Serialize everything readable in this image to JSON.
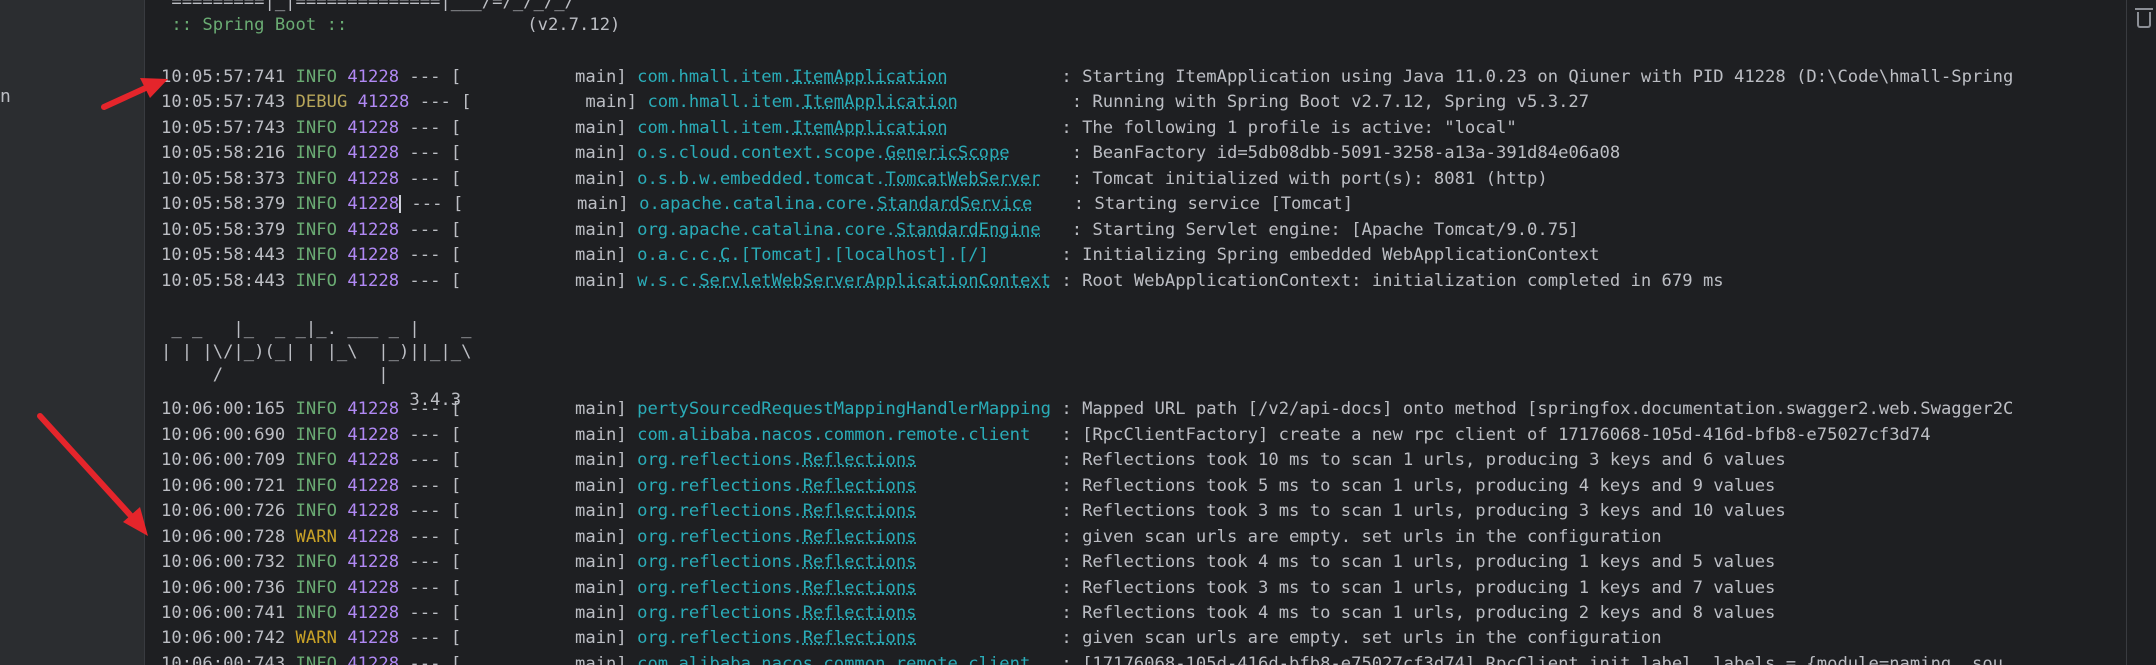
{
  "sidebar": {
    "fragment": "n"
  },
  "banner": {
    "top": " =========|_|==============|___/=/_/_/_/",
    "spring_boot": " :: Spring Boot ::",
    "version": "(v2.7.12)",
    "mp1": " _ _   |_  _ _|_. ___ _ |    _",
    "mp2": "| | |\\/|_)(_| | |_\\  |_)||_|_\\",
    "mp3": "     /               |",
    "mp4": "                        3.4.3"
  },
  "logs": [
    {
      "time": "10:05:57:741",
      "level": "INFO",
      "pid": "41228",
      "sep": "--- [",
      "thread": "           main]",
      "pkg": "com.hmall.item.",
      "cls": "ItemApplication",
      "pad": "           ",
      "msg": ": Starting ItemApplication using Java 11.0.23 on Qiuner with PID 41228 (D:\\Code\\hmall-Spring"
    },
    {
      "time": "10:05:57:743",
      "level": "DEBUG",
      "pid": "41228",
      "sep": "--- [",
      "thread": "           main]",
      "pkg": "com.hmall.item.",
      "cls": "ItemApplication",
      "pad": "           ",
      "msg": ": Running with Spring Boot v2.7.12, Spring v5.3.27"
    },
    {
      "time": "10:05:57:743",
      "level": "INFO",
      "pid": "41228",
      "sep": "--- [",
      "thread": "           main]",
      "pkg": "com.hmall.item.",
      "cls": "ItemApplication",
      "pad": "           ",
      "msg": ": The following 1 profile is active: \"local\""
    },
    {
      "time": "10:05:58:216",
      "level": "INFO",
      "pid": "41228",
      "sep": "--- [",
      "thread": "           main]",
      "pkg": "o.s.cloud.context.scope.",
      "cls": "GenericScope",
      "pad": "      ",
      "msg": ": BeanFactory id=5db08dbb-5091-3258-a13a-391d84e06a08"
    },
    {
      "time": "10:05:58:373",
      "level": "INFO",
      "pid": "41228",
      "sep": "--- [",
      "thread": "           main]",
      "pkg": "o.s.b.w.embedded.tomcat.",
      "cls": "TomcatWebServer",
      "pad": "   ",
      "msg": ": Tomcat initialized with port(s): 8081 (http)"
    },
    {
      "time": "10:05:58:379",
      "level": "INFO",
      "pid": "41228",
      "sep": "--- [",
      "thread": "           main]",
      "pkg": "o.apache.catalina.core.",
      "cls": "StandardService",
      "pad": "    ",
      "msg": ": Starting service [Tomcat]"
    },
    {
      "time": "10:05:58:379",
      "level": "INFO",
      "pid": "41228",
      "sep": "--- [",
      "thread": "           main]",
      "pkg": "org.apache.catalina.core.",
      "cls": "StandardEngine",
      "pad": "   ",
      "msg": ": Starting Servlet engine: [Apache Tomcat/9.0.75]"
    },
    {
      "time": "10:05:58:443",
      "level": "INFO",
      "pid": "41228",
      "sep": "--- [",
      "thread": "           main]",
      "pkg": "o.a.c.c.",
      "cls": "C",
      "pad": "",
      "msg2pre": ".[Tomcat].[localhost].[/]",
      "pad2": "       ",
      "msg": ": Initializing Spring embedded WebApplicationContext"
    },
    {
      "time": "10:05:58:443",
      "level": "INFO",
      "pid": "41228",
      "sep": "--- [",
      "thread": "           main]",
      "pkg": "w.s.c.",
      "cls": "ServletWebServerApplicationContext",
      "pad": " ",
      "msg": ": Root WebApplicationContext: initialization completed in 679 ms"
    },
    {
      "time": "10:06:00:165",
      "level": "INFO",
      "pid": "41228",
      "sep": "--- [",
      "thread": "           main]",
      "pkg": "pertySourcedRequestMappingHandlerMapping",
      "cls": "",
      "pad": " ",
      "msg": ": Mapped URL path [/v2/api-docs] onto method [springfox.documentation.swagger2.web.Swagger2C"
    },
    {
      "time": "10:06:00:690",
      "level": "INFO",
      "pid": "41228",
      "sep": "--- [",
      "thread": "           main]",
      "pkg": "com.alibaba.nacos.common.remote.client",
      "cls": "",
      "pad": "   ",
      "msg": ": [RpcClientFactory] create a new rpc client of 17176068-105d-416d-bfb8-e75027cf3d74"
    },
    {
      "time": "10:06:00:709",
      "level": "INFO",
      "pid": "41228",
      "sep": "--- [",
      "thread": "           main]",
      "pkg": "org.reflections.",
      "cls": "Reflections",
      "pad": "              ",
      "msg": ": Reflections took 10 ms to scan 1 urls, producing 3 keys and 6 values"
    },
    {
      "time": "10:06:00:721",
      "level": "INFO",
      "pid": "41228",
      "sep": "--- [",
      "thread": "           main]",
      "pkg": "org.reflections.",
      "cls": "Reflections",
      "pad": "              ",
      "msg": ": Reflections took 5 ms to scan 1 urls, producing 4 keys and 9 values"
    },
    {
      "time": "10:06:00:726",
      "level": "INFO",
      "pid": "41228",
      "sep": "--- [",
      "thread": "           main]",
      "pkg": "org.reflections.",
      "cls": "Reflections",
      "pad": "              ",
      "msg": ": Reflections took 3 ms to scan 1 urls, producing 3 keys and 10 values"
    },
    {
      "time": "10:06:00:728",
      "level": "WARN",
      "pid": "41228",
      "sep": "--- [",
      "thread": "           main]",
      "pkg": "org.reflections.",
      "cls": "Reflections",
      "pad": "              ",
      "msg": ": given scan urls are empty. set urls in the configuration"
    },
    {
      "time": "10:06:00:732",
      "level": "INFO",
      "pid": "41228",
      "sep": "--- [",
      "thread": "           main]",
      "pkg": "org.reflections.",
      "cls": "Reflections",
      "pad": "              ",
      "msg": ": Reflections took 4 ms to scan 1 urls, producing 1 keys and 5 values"
    },
    {
      "time": "10:06:00:736",
      "level": "INFO",
      "pid": "41228",
      "sep": "--- [",
      "thread": "           main]",
      "pkg": "org.reflections.",
      "cls": "Reflections",
      "pad": "              ",
      "msg": ": Reflections took 3 ms to scan 1 urls, producing 1 keys and 7 values"
    },
    {
      "time": "10:06:00:741",
      "level": "INFO",
      "pid": "41228",
      "sep": "--- [",
      "thread": "           main]",
      "pkg": "org.reflections.",
      "cls": "Reflections",
      "pad": "              ",
      "msg": ": Reflections took 4 ms to scan 1 urls, producing 2 keys and 8 values"
    },
    {
      "time": "10:06:00:742",
      "level": "WARN",
      "pid": "41228",
      "sep": "--- [",
      "thread": "           main]",
      "pkg": "org.reflections.",
      "cls": "Reflections",
      "pad": "              ",
      "msg": ": given scan urls are empty. set urls in the configuration"
    },
    {
      "time": "10:06:00:743",
      "level": "INFO",
      "pid": "41228",
      "sep": "--- [",
      "thread": "           main]",
      "pkg": "com.alibaba.nacos.common.remote.client",
      "cls": "",
      "pad": "   ",
      "msg": ": [17176068-105d-416d-bfb8-e75027cf3d74] RpcClient init label, labels = {module=naming, sou"
    }
  ],
  "colors": {
    "background": "#1e1f22",
    "info": "#6aab73",
    "debug": "#b8a65a",
    "warn": "#c9a227",
    "pid": "#b189f5",
    "logger": "#2aacb8",
    "arrow": "#e5252b"
  }
}
